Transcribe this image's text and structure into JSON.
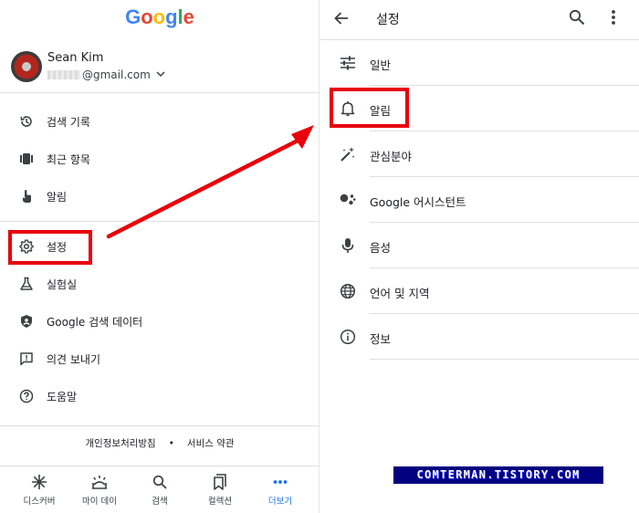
{
  "left_panel": {
    "logo": {
      "letters": [
        "G",
        "o",
        "o",
        "g",
        "l",
        "e"
      ],
      "colors": [
        "#4285F4",
        "#EA4335",
        "#FBBC05",
        "#4285F4",
        "#34A853",
        "#EA4335"
      ]
    },
    "account": {
      "name": "Sean Kim",
      "email_suffix": "@gmail.com"
    },
    "menu": [
      {
        "label": "검색 기록",
        "icon": "history-icon"
      },
      {
        "label": "최근 항목",
        "icon": "recent-items-icon"
      },
      {
        "label": "알림",
        "icon": "notification-hand-icon"
      },
      {
        "label": "설정",
        "icon": "gear-icon"
      },
      {
        "label": "실험실",
        "icon": "flask-icon"
      },
      {
        "label": "Google 검색 데이터",
        "icon": "shield-account-icon"
      },
      {
        "label": "의견 보내기",
        "icon": "feedback-icon"
      },
      {
        "label": "도움말",
        "icon": "help-icon"
      }
    ],
    "footer": {
      "privacy": "개인정보처리방침",
      "separator": "•",
      "terms": "서비스 약관"
    },
    "bottom_nav": [
      {
        "label": "디스커버",
        "icon": "discover-icon",
        "active": false
      },
      {
        "label": "마이 데이",
        "icon": "my-day-icon",
        "active": false
      },
      {
        "label": "검색",
        "icon": "search-icon",
        "active": false
      },
      {
        "label": "컬렉션",
        "icon": "collections-icon",
        "active": false
      },
      {
        "label": "더보기",
        "icon": "more-horiz-icon",
        "active": true
      }
    ]
  },
  "right_panel": {
    "title": "설정",
    "items": [
      {
        "label": "일반",
        "icon": "tune-icon"
      },
      {
        "label": "알림",
        "icon": "bell-icon"
      },
      {
        "label": "관심분야",
        "icon": "magic-wand-icon"
      },
      {
        "label": "Google 어시스턴트",
        "icon": "assistant-icon"
      },
      {
        "label": "음성",
        "icon": "mic-icon"
      },
      {
        "label": "언어 및 지역",
        "icon": "globe-icon"
      },
      {
        "label": "정보",
        "icon": "info-icon"
      }
    ]
  },
  "watermark": "COMTERMAN.TISTORY.COM",
  "colors": {
    "accent": "#1a73e8",
    "highlight": "#e8000b",
    "watermark_bg": "#000080"
  }
}
